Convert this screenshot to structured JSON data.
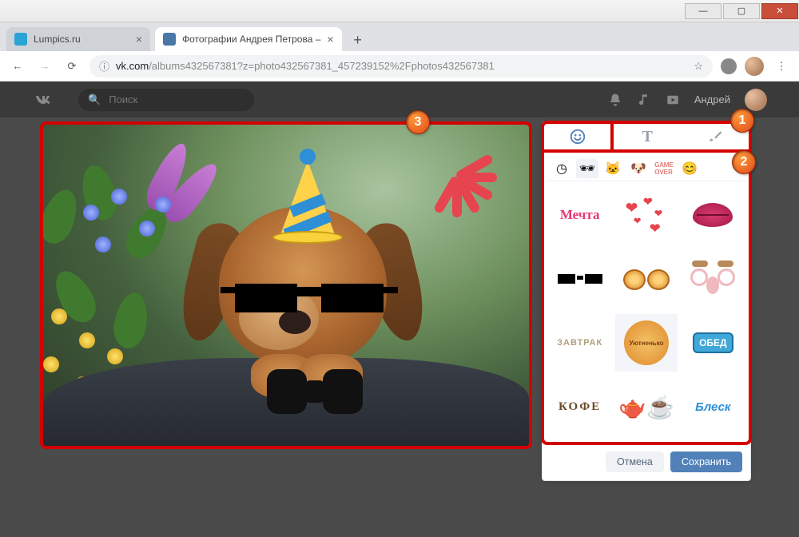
{
  "window": {
    "min": "—",
    "max": "▢",
    "close": "✕"
  },
  "tabs": [
    {
      "title": "Lumpics.ru",
      "favicon": "#2aa4d4"
    },
    {
      "title": "Фотографии Андрея Петрова –",
      "favicon": "#4a76a8"
    }
  ],
  "new_tab": "+",
  "nav": {
    "back": "←",
    "forward": "→",
    "reload": "⟳"
  },
  "omnibox": {
    "host": "vk.com",
    "path": "/albums432567381?z=photo432567381_457239152%2Fphotos432567381",
    "star": "☆"
  },
  "vk": {
    "search_placeholder": "Поиск",
    "username": "Андрей",
    "icons": {
      "bell": "bell",
      "music": "music",
      "play": "play"
    }
  },
  "tool_tabs": {
    "stickers": "stickers",
    "text": "T",
    "brush": "brush"
  },
  "sticker_categories": [
    {
      "name": "recent",
      "glyph": "◷"
    },
    {
      "name": "glasses",
      "glyph": "👓"
    },
    {
      "name": "cat",
      "glyph": "🐱"
    },
    {
      "name": "dog",
      "glyph": "🐶"
    },
    {
      "name": "gameover",
      "glyph": "🎮"
    },
    {
      "name": "emoji",
      "glyph": "😊"
    }
  ],
  "stickers": {
    "mechta": "Мечта",
    "zavtrak": "ЗАВТРАК",
    "uyutnenko": "Уютненько",
    "obed": "ОБЕД",
    "kofe": "КОФЕ",
    "blesk": "Блеск"
  },
  "buttons": {
    "cancel": "Отмена",
    "save": "Сохранить"
  },
  "badges": {
    "one": "1",
    "two": "2",
    "three": "3"
  }
}
